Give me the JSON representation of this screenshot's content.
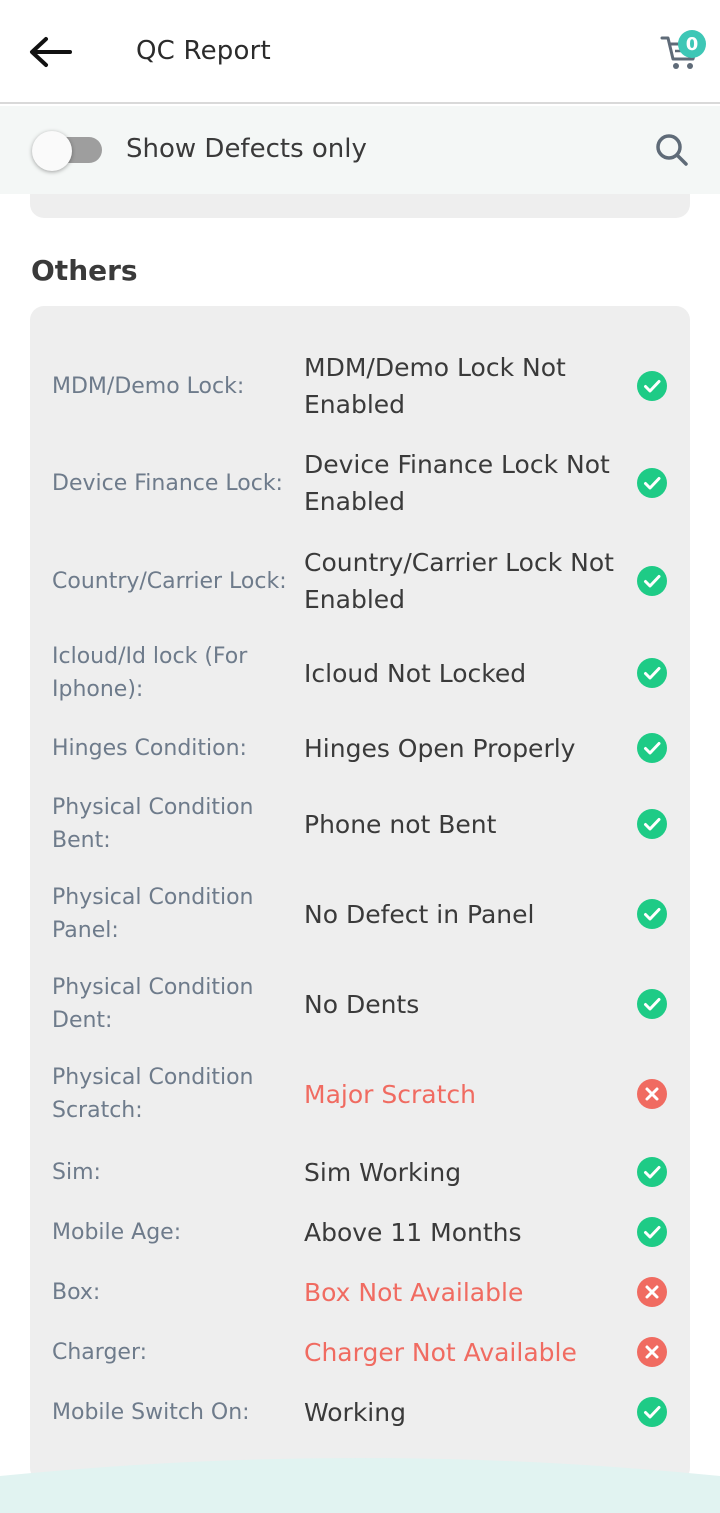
{
  "header": {
    "title": "QC Report",
    "cart_count": "0"
  },
  "filter": {
    "label": "Show Defects only",
    "enabled": false
  },
  "section": {
    "title": "Others"
  },
  "colors": {
    "accent": "#3ec7b6",
    "pass": "#1ecb86",
    "fail": "#f06b61"
  },
  "rows": [
    {
      "label": "MDM/Demo Lock:",
      "value": "MDM/Demo Lock Not Enabled",
      "status": "pass"
    },
    {
      "label": "Device Finance Lock:",
      "value": "Device Finance Lock Not Enabled",
      "status": "pass"
    },
    {
      "label": "Country/Carrier Lock:",
      "value": "Country/Carrier Lock Not Enabled",
      "status": "pass"
    },
    {
      "label": "Icloud/Id lock (For Iphone):",
      "value": "Icloud Not Locked",
      "status": "pass"
    },
    {
      "label": "Hinges Condition:",
      "value": "Hinges Open Properly",
      "status": "pass"
    },
    {
      "label": "Physical Condition Bent:",
      "value": "Phone not Bent",
      "status": "pass"
    },
    {
      "label": "Physical Condition Panel:",
      "value": "No Defect in Panel",
      "status": "pass"
    },
    {
      "label": "Physical Condition Dent:",
      "value": "No Dents",
      "status": "pass"
    },
    {
      "label": "Physical Condition Scratch:",
      "value": "Major Scratch",
      "status": "fail"
    },
    {
      "label": "Sim:",
      "value": "Sim Working",
      "status": "pass"
    },
    {
      "label": "Mobile Age:",
      "value": "Above 11 Months",
      "status": "pass"
    },
    {
      "label": "Box:",
      "value": "Box Not Available",
      "status": "fail"
    },
    {
      "label": "Charger:",
      "value": "Charger Not Available",
      "status": "fail"
    },
    {
      "label": "Mobile Switch On:",
      "value": "Working",
      "status": "pass"
    }
  ]
}
